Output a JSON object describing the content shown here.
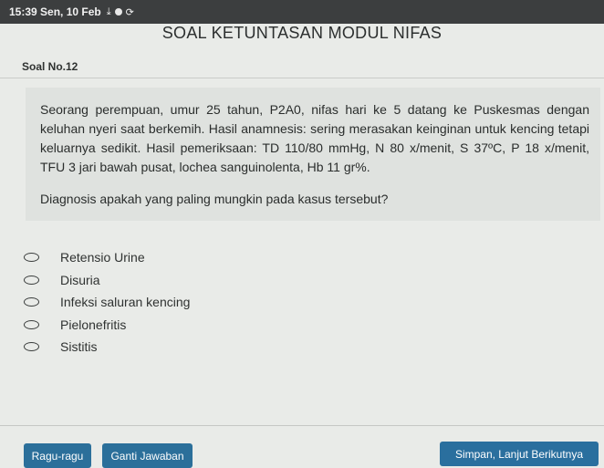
{
  "status_bar": {
    "time_date": "15:39 Sen, 10 Feb",
    "icons": [
      "download-icon",
      "circle-icon",
      "sync-icon"
    ]
  },
  "header": {
    "title": "SOAL KETUNTASAN MODUL NIFAS"
  },
  "question": {
    "number_label": "Soal No.12",
    "stem": "Seorang perempuan, umur 25 tahun, P2A0, nifas hari ke 5 datang ke Puskesmas dengan keluhan nyeri saat berkemih. Hasil anamnesis: sering merasakan keinginan untuk kencing tetapi keluarnya sedikit. Hasil pemeriksaan: TD 110/80 mmHg, N 80 x/menit, S 37ºC, P 18 x/menit, TFU 3 jari bawah pusat, lochea sanguinolenta, Hb 11 gr%.",
    "prompt": "Diagnosis apakah yang paling mungkin pada kasus tersebut?"
  },
  "options": [
    {
      "label": "Retensio Urine",
      "selected": false
    },
    {
      "label": "Disuria",
      "selected": false
    },
    {
      "label": "Infeksi saluran kencing",
      "selected": false
    },
    {
      "label": "Pielonefritis",
      "selected": false
    },
    {
      "label": "Sistitis",
      "selected": false
    }
  ],
  "buttons": {
    "ragu_label": "Ragu-ragu",
    "ganti_label": "Ganti Jawaban",
    "simpan_label": "Simpan, Lanjut Berikutnya"
  },
  "colors": {
    "button_blue": "#2b6f9a",
    "status_bar": "#3c3e3f",
    "background": "#e9ebe8"
  }
}
